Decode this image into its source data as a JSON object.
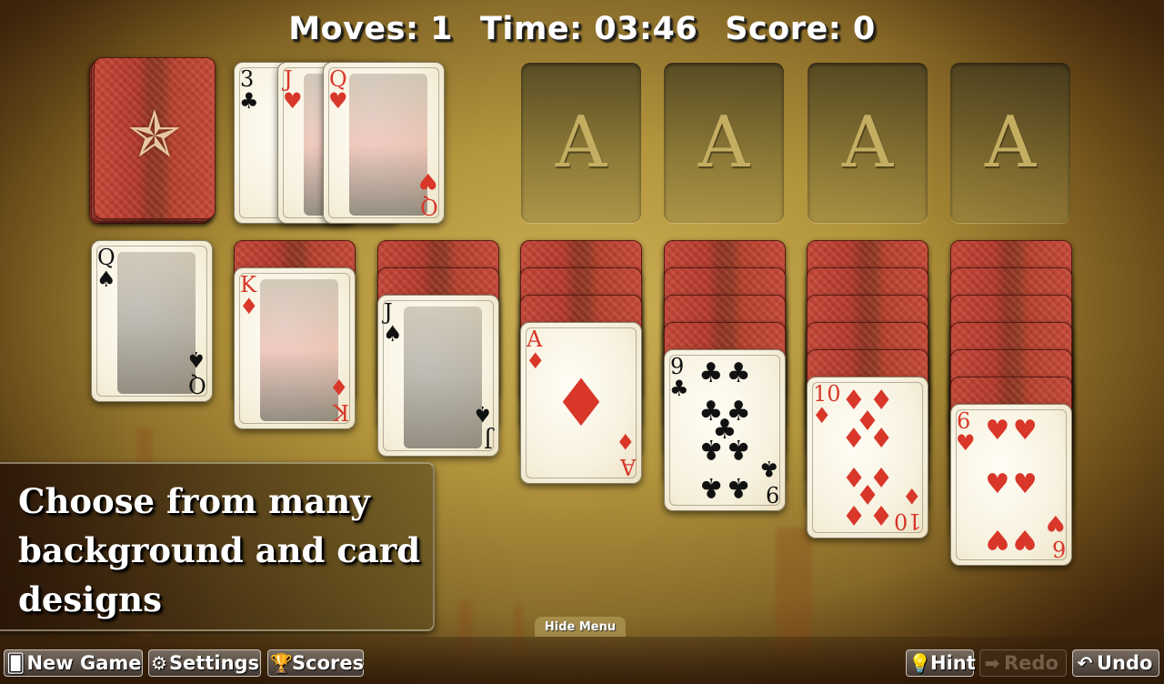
{
  "status": {
    "moves_label": "Moves:",
    "moves": "1",
    "time_label": "Time:",
    "time": "03:46",
    "score_label": "Score:",
    "score": "0"
  },
  "stock": {
    "icon": "sheriff-star-icon",
    "glyph": "✯"
  },
  "waste": [
    {
      "rank": "3",
      "suit": "♣",
      "color": "black"
    },
    {
      "rank": "J",
      "suit": "♥",
      "color": "red"
    },
    {
      "rank": "Q",
      "suit": "♥",
      "color": "red"
    }
  ],
  "foundations": [
    {
      "label": "A"
    },
    {
      "label": "A"
    },
    {
      "label": "A"
    },
    {
      "label": "A"
    }
  ],
  "tableau": [
    {
      "face_down": 0,
      "top": {
        "rank": "Q",
        "suit": "♠",
        "color": "black"
      }
    },
    {
      "face_down": 1,
      "top": {
        "rank": "K",
        "suit": "♦",
        "color": "red"
      }
    },
    {
      "face_down": 2,
      "top": {
        "rank": "J",
        "suit": "♠",
        "color": "black"
      }
    },
    {
      "face_down": 3,
      "top": {
        "rank": "A",
        "suit": "♦",
        "color": "red"
      }
    },
    {
      "face_down": 4,
      "top": {
        "rank": "9",
        "suit": "♣",
        "color": "black"
      }
    },
    {
      "face_down": 5,
      "top": {
        "rank": "10",
        "suit": "♦",
        "color": "red"
      }
    },
    {
      "face_down": 6,
      "top": {
        "rank": "6",
        "suit": "♥",
        "color": "red"
      }
    }
  ],
  "promo": {
    "text": "Choose from many background and card designs"
  },
  "hide_menu_label": "Hide Menu",
  "toolbar": {
    "new_game": {
      "label": "New Game",
      "icon": "🂠"
    },
    "settings": {
      "label": "Settings",
      "icon": "⚙"
    },
    "scores": {
      "label": "Scores",
      "icon": "🏆"
    },
    "hint": {
      "label": "Hint",
      "icon": "💡"
    },
    "redo": {
      "label": "Redo",
      "icon": "➡",
      "enabled": false
    },
    "undo": {
      "label": "Undo",
      "icon": "↶"
    }
  },
  "colors": {
    "red_suit": "#d8372a",
    "card_back": "#b03a2e",
    "table": "#b59a4a"
  }
}
